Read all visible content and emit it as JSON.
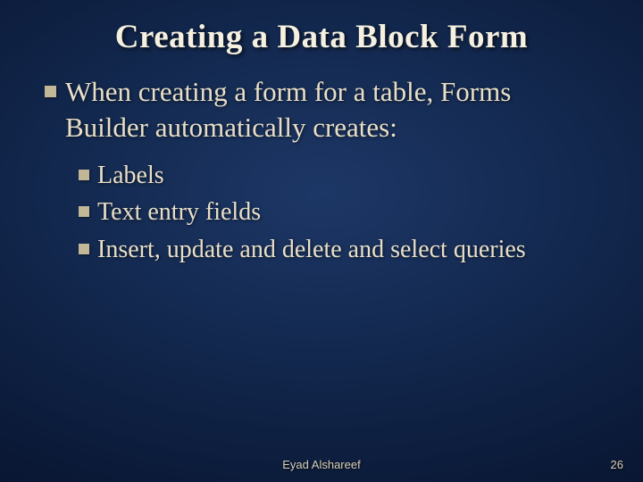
{
  "title": "Creating a Data Block Form",
  "body": {
    "l1": "When creating a form for a table, Forms Builder automatically creates:",
    "l2": [
      "Labels",
      "Text entry fields",
      "Insert, update and delete and select queries"
    ]
  },
  "footer": {
    "author": "Eyad Alshareef",
    "page": "26"
  }
}
